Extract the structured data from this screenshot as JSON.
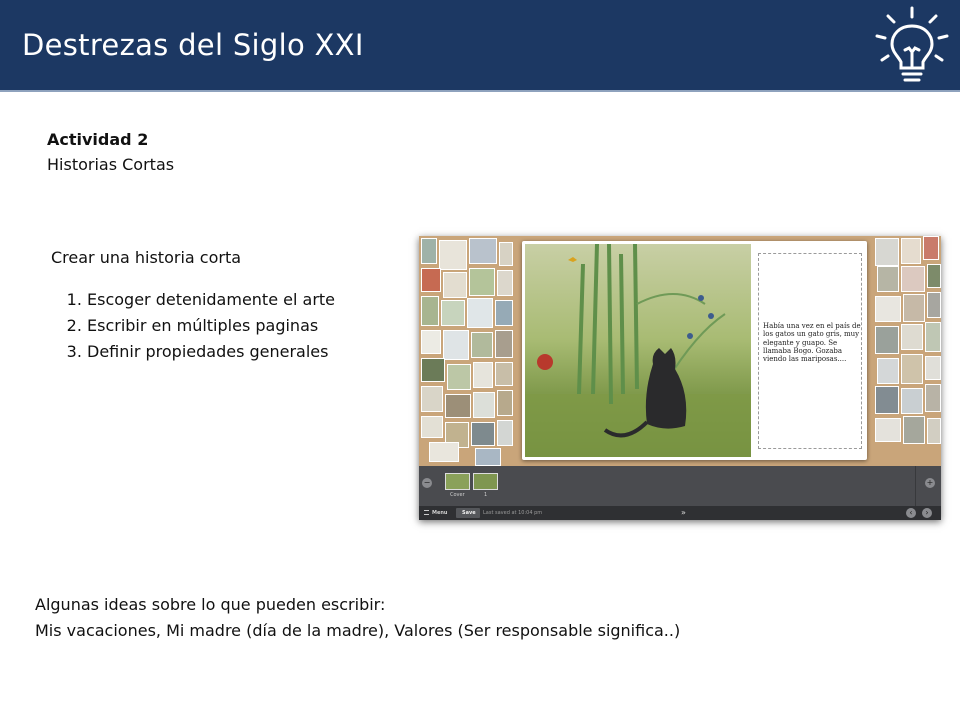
{
  "header": {
    "title": "Destrezas del Siglo XXI",
    "icon": "lightbulb-icon"
  },
  "activity": {
    "number": "Actividad 2",
    "subtitle": "Historias Cortas"
  },
  "task": {
    "heading": "Crear una historia corta",
    "steps": [
      "Escoger detenidamente el arte",
      "Escribir en múltiples paginas",
      "Definir propiedades generales"
    ]
  },
  "ideas": {
    "intro": "Algunas ideas sobre lo que pueden escribir:",
    "list": "Mis vacaciones, Mi madre (día de la madre), Valores (Ser responsable significa..)"
  },
  "app": {
    "story_text": "Había una vez en el país de los gatos un gato gris, muy elegante y guapo. Se llamaba Bogo. Gozaba viendo las mariposas....",
    "filmstrip": {
      "cover_label": "Cover",
      "page_label": "1"
    },
    "toolbar": {
      "menu_label": "Menu",
      "save_label": "Save",
      "status": "Last saved at 10:04 pm"
    }
  }
}
